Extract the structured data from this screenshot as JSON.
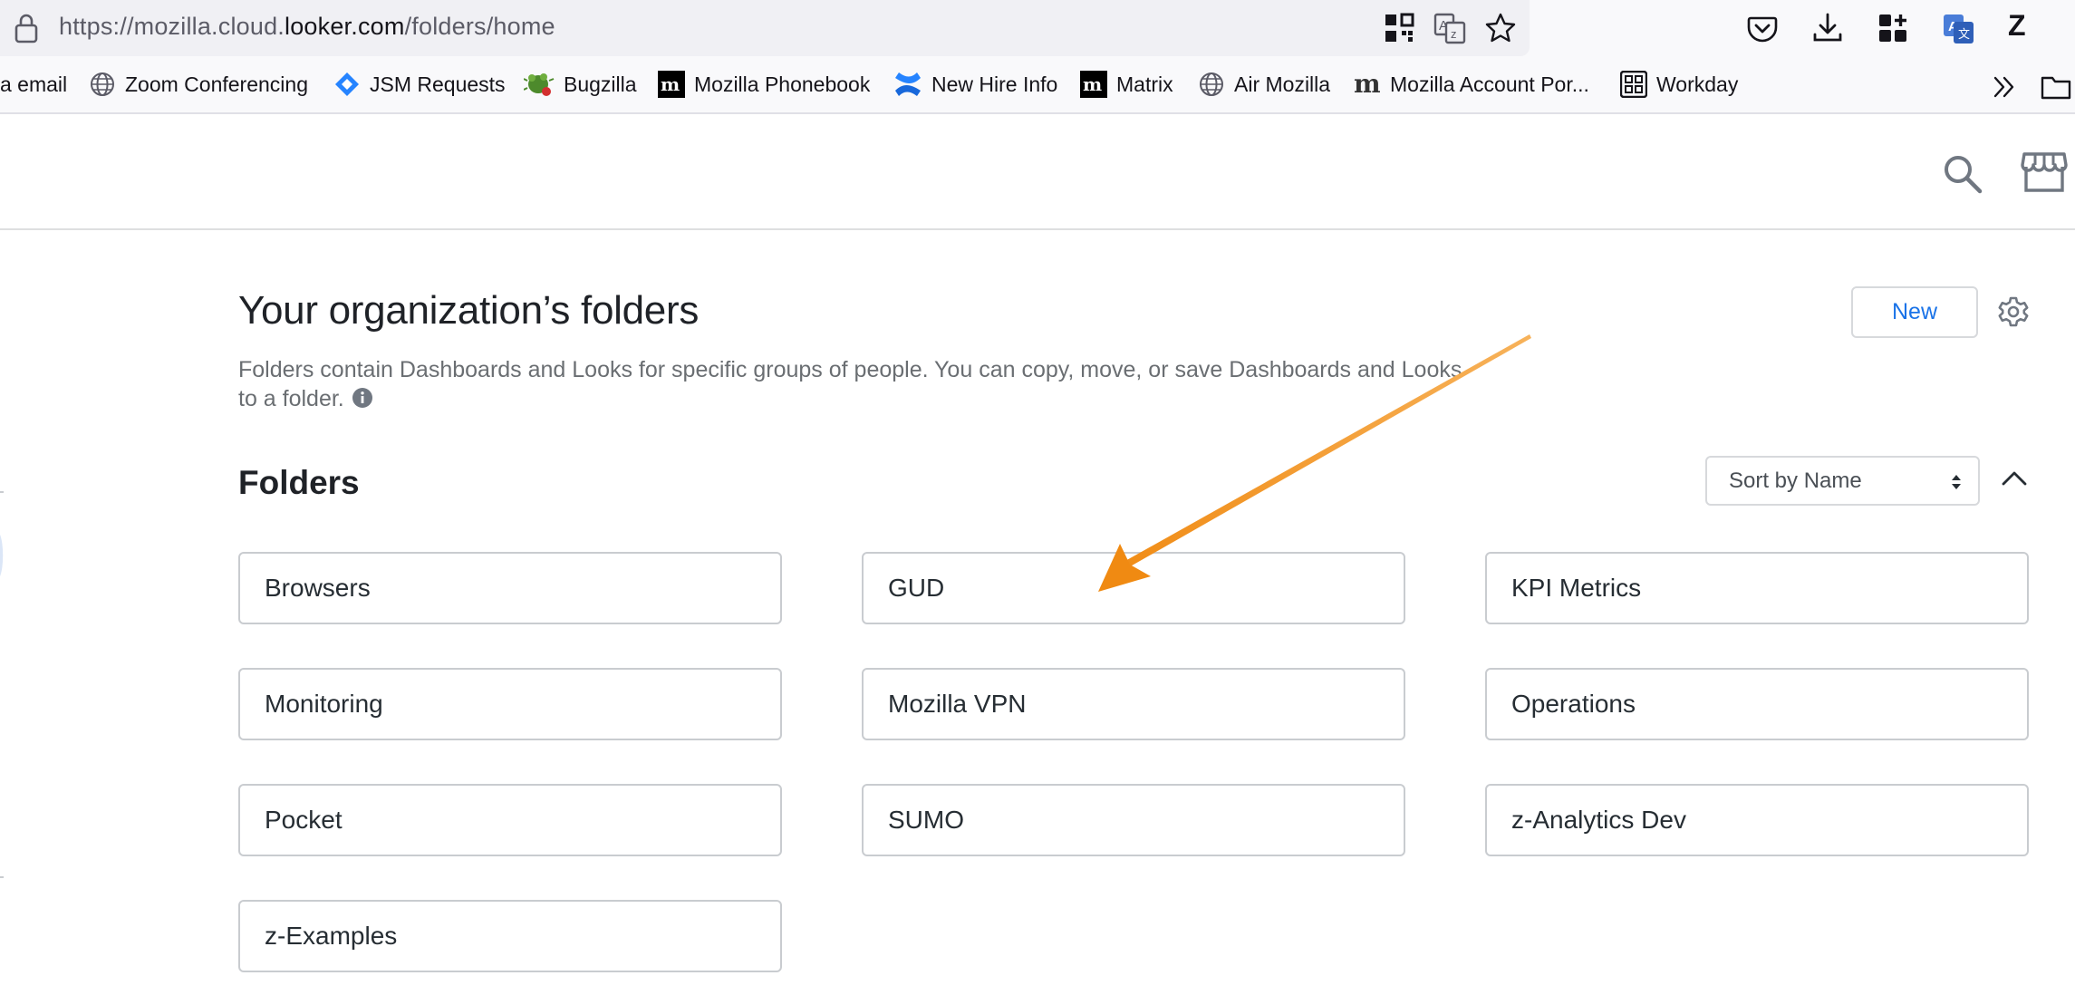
{
  "browser": {
    "url_prefix": "https://mozilla.cloud.",
    "url_host": "looker.com",
    "url_path": "/folders/home",
    "profile_initial": "Z",
    "bookmarks": [
      {
        "label": "a email",
        "icon": "none"
      },
      {
        "label": "Zoom Conferencing",
        "icon": "globe-icon"
      },
      {
        "label": "JSM Requests",
        "icon": "jira-icon"
      },
      {
        "label": "Bugzilla",
        "icon": "bug-icon"
      },
      {
        "label": "Mozilla Phonebook",
        "icon": "mozilla-m-icon"
      },
      {
        "label": "New Hire Info",
        "icon": "confluence-icon"
      },
      {
        "label": "Matrix",
        "icon": "mozilla-m-icon"
      },
      {
        "label": "Air Mozilla",
        "icon": "globe-icon"
      },
      {
        "label": "Mozilla Account Por...",
        "icon": "mozilla-m-icon"
      },
      {
        "label": "Workday",
        "icon": "grid-icon"
      }
    ]
  },
  "page": {
    "title": "Your organization’s folders",
    "description": "Folders contain Dashboards and Looks for specific groups of people. You can copy, move, or save Dashboards and Looks to a folder.",
    "new_button_label": "New",
    "section_title": "Folders",
    "sort_selected": "Sort by Name",
    "folders": [
      "Browsers",
      "GUD",
      "KPI Metrics",
      "Monitoring",
      "Mozilla VPN",
      "Operations",
      "Pocket",
      "SUMO",
      "z-Analytics Dev",
      "z-Examples"
    ]
  },
  "colors": {
    "accent": "#1a73e8",
    "annotation_arrow": "#f3961f",
    "card_border": "#c9ccd0"
  }
}
